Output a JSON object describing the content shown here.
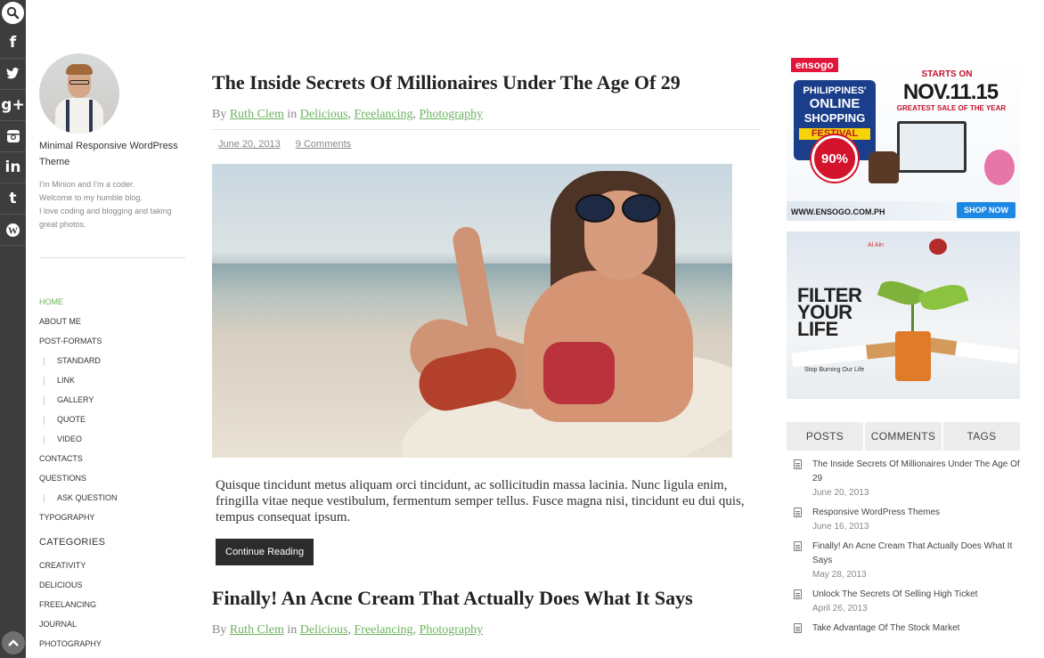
{
  "sidebar_icons": [
    "search-icon",
    "facebook-icon",
    "twitter-icon",
    "google-plus-icon",
    "instagram-icon",
    "linkedin-icon",
    "tumblr-icon",
    "wordpress-icon"
  ],
  "social_glyphs": {
    "facebook": "f",
    "twitter": "t",
    "google_plus": "g+",
    "instagram": "◙",
    "linkedin": "in",
    "tumblr": "t",
    "wordpress": "W"
  },
  "profile": {
    "site_title": "Minimal Responsive WordPress Theme",
    "bio_lines": [
      "I'm Minion and I'm a coder.",
      "Welcome to my humble blog.",
      "I love coding and blogging and taking great photos."
    ]
  },
  "nav": {
    "items": [
      {
        "label": "HOME",
        "active": true,
        "sub": false
      },
      {
        "label": "ABOUT ME",
        "sub": false
      },
      {
        "label": "POST-FORMATS",
        "sub": false
      },
      {
        "label": "STANDARD",
        "sub": true
      },
      {
        "label": "LINK",
        "sub": true
      },
      {
        "label": "GALLERY",
        "sub": true
      },
      {
        "label": "QUOTE",
        "sub": true
      },
      {
        "label": "VIDEO",
        "sub": true
      },
      {
        "label": "CONTACTS",
        "sub": false
      },
      {
        "label": "QUESTIONS",
        "sub": false
      },
      {
        "label": "ASK QUESTION",
        "sub": true
      },
      {
        "label": "TYPOGRAPHY",
        "sub": false
      }
    ]
  },
  "categories": {
    "heading": "CATEGORIES",
    "items": [
      "CREATIVITY",
      "DELICIOUS",
      "FREELANCING",
      "JOURNAL",
      "PHOTOGRAPHY"
    ]
  },
  "posts": [
    {
      "title": "The Inside Secrets Of Millionaires Under The Age Of 29",
      "by": "By",
      "author": "Ruth Clem",
      "in": "in",
      "cats": [
        "Delicious",
        "Freelancing",
        "Photography"
      ],
      "date": "June 20, 2013",
      "comments": "9 Comments",
      "excerpt": "Quisque tincidunt metus aliquam orci tincidunt, ac sollicitudin massa lacinia. Nunc ligula enim, fringilla vitae neque vestibulum, fermentum semper tellus. Fusce magna nisi, tincidunt eu dui quis, tempus consequat ipsum.",
      "button": "Continue Reading"
    },
    {
      "title": "Finally! An Acne Cream That Actually Does What It Says",
      "by": "By",
      "author": "Ruth Clem",
      "in": "in",
      "cats": [
        "Delicious",
        "Freelancing",
        "Photography"
      ]
    }
  ],
  "ad1": {
    "brand": "ensogo",
    "fest": [
      "PHILIPPINES'",
      "ONLINE",
      "SHOPPING",
      "FESTIVAL"
    ],
    "starts": "STARTS ON",
    "date": "NOV.11.15",
    "tagline": "GREATEST SALE OF THE YEAR",
    "discount": "90%",
    "url": "WWW.ENSOGO.COM.PH",
    "cta": "SHOP NOW"
  },
  "ad2": {
    "headline_1": "FILTER",
    "headline_2": "YOUR",
    "headline_3": "LIFE",
    "caption": "Stop Burning Our Life"
  },
  "tabs": [
    "POSTS",
    "COMMENTS",
    "TAGS"
  ],
  "popular": [
    {
      "title": "The Inside Secrets Of Millionaires Under The Age Of 29",
      "date": "June 20, 2013"
    },
    {
      "title": "Responsive WordPress Themes",
      "date": "June 16, 2013"
    },
    {
      "title": "Finally! An Acne Cream That Actually Does What It Says",
      "date": "May 28, 2013"
    },
    {
      "title": "Unlock The Secrets Of Selling High Ticket",
      "date": "April 26, 2013"
    },
    {
      "title": "Take Advantage Of The Stock Market",
      "date": ""
    }
  ],
  "colors": {
    "accent": "#6bb35d",
    "sidebar": "#3d3d3d",
    "button": "#2c2c2c"
  }
}
